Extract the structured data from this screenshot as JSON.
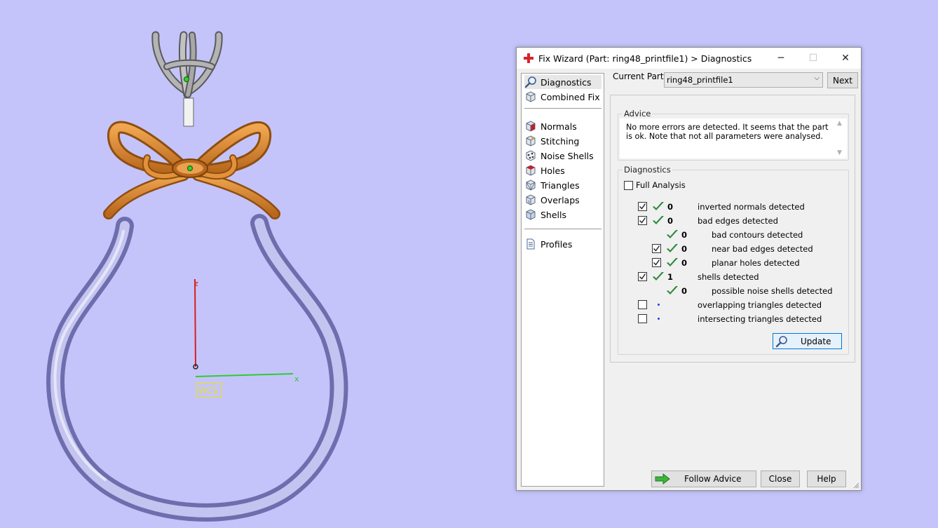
{
  "viewport": {
    "axis_x_label": "x",
    "axis_z_label": "z",
    "wcs_label": "WCS"
  },
  "dialog": {
    "title": "Fix Wizard (Part: ring48_printfile1) > Diagnostics",
    "min_glyph": "─",
    "max_glyph": "☐",
    "close_glyph": "✕"
  },
  "nav": {
    "items": [
      {
        "label": "Diagnostics",
        "icon": "magnifier-icon"
      },
      {
        "label": "Combined Fix",
        "icon": "cube-icon"
      },
      {
        "label": "Normals",
        "icon": "normals-cube-icon"
      },
      {
        "label": "Stitching",
        "icon": "stitching-cube-icon"
      },
      {
        "label": "Noise Shells",
        "icon": "noise-shells-icon"
      },
      {
        "label": "Holes",
        "icon": "holes-cube-icon"
      },
      {
        "label": "Triangles",
        "icon": "triangles-cube-icon"
      },
      {
        "label": "Overlaps",
        "icon": "overlaps-cube-icon"
      },
      {
        "label": "Shells",
        "icon": "shells-cube-icon"
      },
      {
        "label": "Profiles",
        "icon": "document-icon"
      }
    ]
  },
  "current_part": {
    "label": "Current Part:",
    "value": "ring48_printfile1",
    "arrow": "⌵"
  },
  "next_label": "Next",
  "advice": {
    "title": "Advice",
    "text": "No more errors are detected. It seems that the part is ok. Note that not all parameters were analysed."
  },
  "diagnostics": {
    "title": "Diagnostics",
    "full_analysis_label": "Full Analysis",
    "full_analysis_checked": false,
    "rows": [
      {
        "checkbox": true,
        "checked": true,
        "status": "ok",
        "count": "0",
        "label": "inverted normals detected",
        "indent": 0
      },
      {
        "checkbox": true,
        "checked": true,
        "status": "ok",
        "count": "0",
        "label": "bad edges detected",
        "indent": 0
      },
      {
        "checkbox": false,
        "checked": false,
        "status": "ok",
        "count": "0",
        "label": "bad contours detected",
        "indent": 1
      },
      {
        "checkbox": true,
        "checked": true,
        "status": "ok",
        "count": "0",
        "label": "near bad edges detected",
        "indent": 1
      },
      {
        "checkbox": true,
        "checked": true,
        "status": "ok",
        "count": "0",
        "label": "planar holes detected",
        "indent": 1
      },
      {
        "checkbox": true,
        "checked": true,
        "status": "ok",
        "count": "1",
        "label": "shells detected",
        "indent": 0
      },
      {
        "checkbox": false,
        "checked": false,
        "status": "ok",
        "count": "0",
        "label": "possible noise shells detected",
        "indent": 1
      },
      {
        "checkbox": true,
        "checked": false,
        "status": "dot",
        "count": "",
        "label": "overlapping triangles detected",
        "indent": 0
      },
      {
        "checkbox": true,
        "checked": false,
        "status": "dot",
        "count": "",
        "label": "intersecting triangles detected",
        "indent": 0
      }
    ],
    "update_label": "Update"
  },
  "buttons": {
    "follow_advice": "Follow Advice",
    "close": "Close",
    "help": "Help"
  },
  "colors": {
    "background": "#c4c4fb",
    "ring_band": "#a9a9dc",
    "bow": "#d9872a",
    "prongs": "#9c9c9c",
    "check_green": "#2e8b3a",
    "accent_blue": "#0078d7"
  }
}
